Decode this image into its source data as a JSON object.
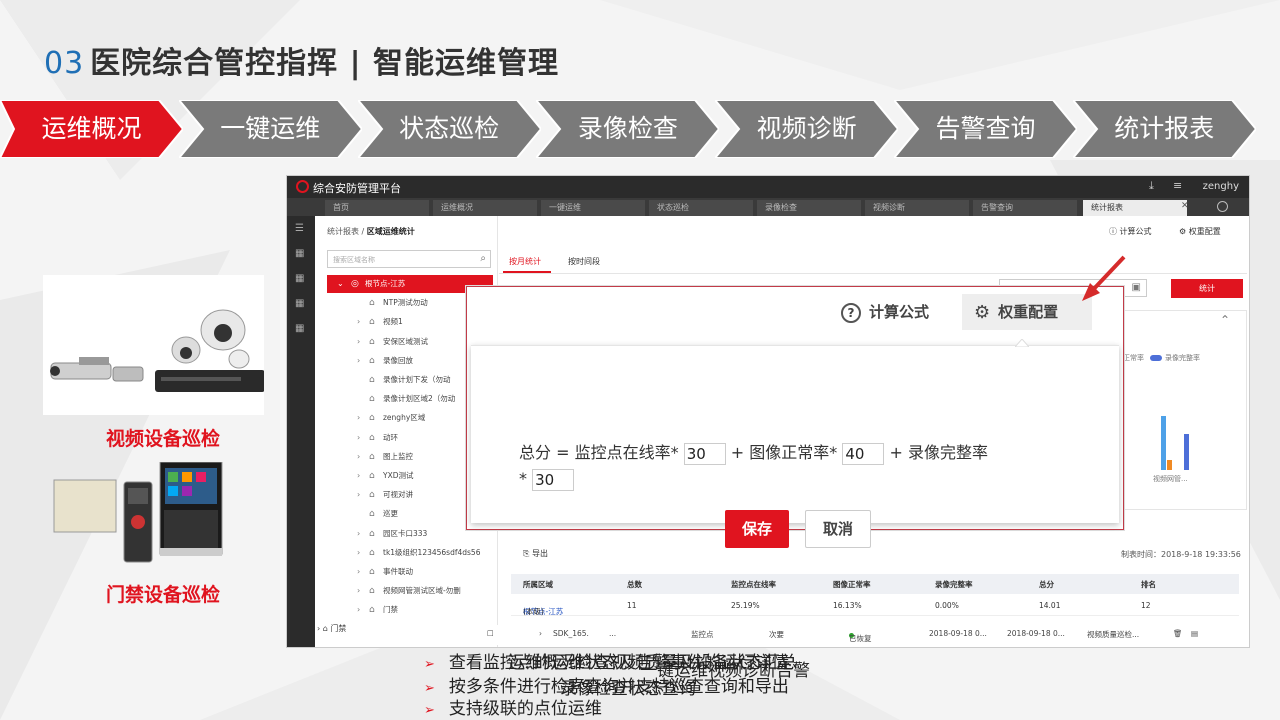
{
  "title": {
    "num": "03",
    "text": "医院综合管控指挥 | 智能运维管理"
  },
  "steps": [
    "运维概况",
    "一键运维",
    "状态巡检",
    "录像检查",
    "视频诊断",
    "告警查询",
    "统计报表"
  ],
  "colors": {
    "accent": "#e0141f",
    "step_gray": "#7a7a7a",
    "num_blue": "#1f6fb5"
  },
  "left_labels": {
    "video": "视频设备巡检",
    "access": "门禁设备巡检"
  },
  "app": {
    "brand": "综合安防管理平台",
    "user": "zenghy",
    "tabs": [
      "首页",
      "运维概况",
      "一键运维",
      "状态巡检",
      "录像检查",
      "视频诊断",
      "告警查询",
      "统计报表"
    ],
    "breadcrumb": {
      "parent": "统计报表",
      "current": "区域运维统计"
    },
    "calc_link": "计算公式",
    "weight_link": "权重配置",
    "search_placeholder": "搜索区域名称",
    "tree": [
      "根节点-江苏",
      "NTP测试勿动",
      "视频1",
      "安保区域测试",
      "录像回放",
      "录像计划下发（勿动",
      "录像计划区域2（勿动",
      "zenghy区域",
      "动环",
      "图上监控",
      "YXD测试",
      "可视对讲",
      "巡更",
      "园区卡口333",
      "tk1级组织123456sdf4ds56",
      "事件联动",
      "视频网管测试区域-勿删",
      "门禁"
    ],
    "subtabs": [
      "按月统计",
      "按时间段"
    ],
    "stat_button": "统计",
    "legend": [
      "正常率",
      "录像完整率"
    ],
    "xlabel": "视频网管...",
    "export": "导出",
    "make_time": "制表时间：2018-9-18 19:33:56",
    "table": {
      "headers": [
        "所属区域",
        "总数",
        "监控点在线率",
        "图像正常率",
        "录像完整率",
        "总分",
        "排名"
      ],
      "row": [
        "根节点-江苏",
        "(本级)",
        "11",
        "25.19%",
        "16.13%",
        "0.00%",
        "14.01",
        "12"
      ]
    },
    "bottom_row": [
      "SDK_165.",
      "...",
      "监控点",
      "次要",
      "已恢复",
      "2018-09-18 0...",
      "2018-09-18 0...",
      "视频质量巡检..."
    ],
    "bottom_tree": "门禁"
  },
  "dialog": {
    "calc": "计算公式",
    "weight": "权重配置",
    "f_total": "总分 = 监控点在线率*",
    "v1": "30",
    "f_plus1": "+ 图像正常率*",
    "v2": "40",
    "f_plus2": "+ 录像完整率",
    "f_mult": "*",
    "v3": "30",
    "save": "保存",
    "cancel": "取消"
  },
  "bullets": [
    "查看监控点的运维状态及告警事件的运行详情",
    "按多条件进行检索查询并支持巡查查询和导出",
    "支持级联的点位运维"
  ],
  "overlap_fragments": [
    "运维概况检查视频质量及设备状态汇总",
    "录像检查状态查询",
    "一键运维视频诊断告警"
  ]
}
